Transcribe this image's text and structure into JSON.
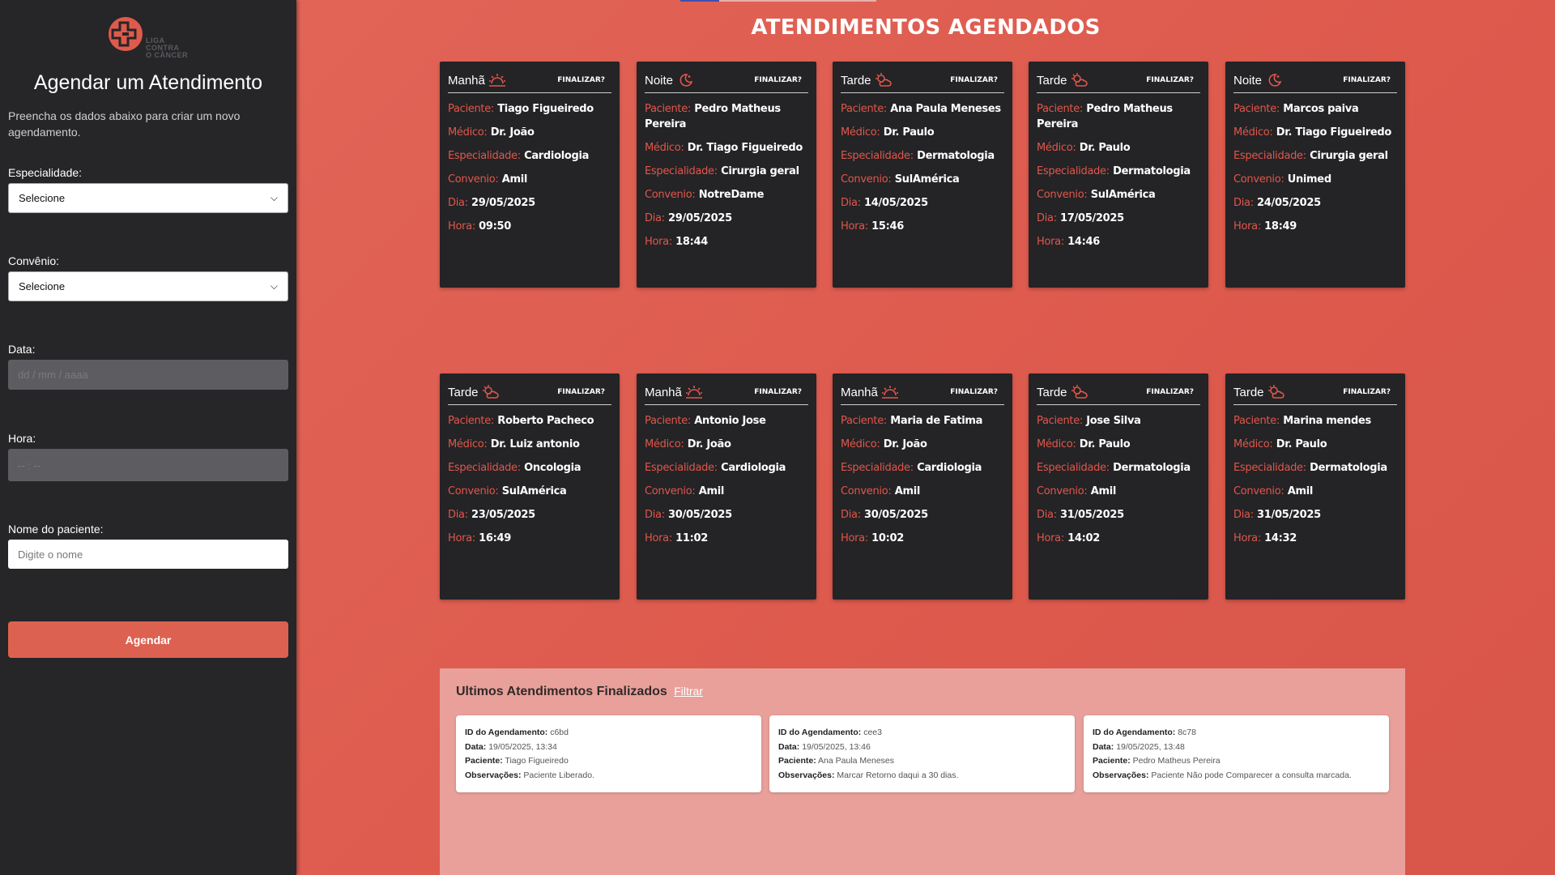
{
  "sidebar": {
    "logo_lines": [
      "LIGA",
      "CONTRA",
      "O CÂNCER"
    ],
    "title": "Agendar um Atendimento",
    "description": "Preencha os dados abaixo para criar um novo agendamento.",
    "specialty": {
      "label": "Especialidade:",
      "value": "Selecione"
    },
    "insurance": {
      "label": "Convênio:",
      "value": "Selecione"
    },
    "date": {
      "label": "Data:",
      "placeholder": "dd / mm / aaaa"
    },
    "time": {
      "label": "Hora:",
      "placeholder": "-- : --"
    },
    "patient": {
      "label": "Nome do paciente:",
      "placeholder": "Digite o nome"
    },
    "submit_label": "Agendar"
  },
  "main": {
    "title": "ATENDIMENTOS AGENDADOS",
    "finalize_label": "FINALIZAR?",
    "field_labels": {
      "patient": "Paciente:",
      "doctor": "Médico:",
      "specialty": "Especialidade:",
      "insurance": "Convenio:",
      "day": "Dia:",
      "hour": "Hora:"
    },
    "appointments": [
      {
        "period": "Manhã",
        "icon": "sunrise-icon",
        "patient": "Tiago Figueiredo",
        "doctor": "Dr. João",
        "specialty": "Cardiologia",
        "insurance": "Amil",
        "day": "29/05/2025",
        "hour": "09:50"
      },
      {
        "period": "Noite",
        "icon": "moon-icon",
        "patient": "Pedro Matheus Pereira",
        "doctor": "Dr. Tiago Figueiredo",
        "specialty": "Cirurgia geral",
        "insurance": "NotreDame",
        "day": "29/05/2025",
        "hour": "18:44"
      },
      {
        "period": "Tarde",
        "icon": "sun-cloud-icon",
        "patient": "Ana Paula Meneses",
        "doctor": "Dr. Paulo",
        "specialty": "Dermatologia",
        "insurance": "SulAmérica",
        "day": "14/05/2025",
        "hour": "15:46"
      },
      {
        "period": "Tarde",
        "icon": "sun-cloud-icon",
        "patient": "Pedro Matheus Pereira",
        "doctor": "Dr. Paulo",
        "specialty": "Dermatologia",
        "insurance": "SulAmérica",
        "day": "17/05/2025",
        "hour": "14:46"
      },
      {
        "period": "Noite",
        "icon": "moon-icon",
        "patient": "Marcos paiva",
        "doctor": "Dr. Tiago Figueiredo",
        "specialty": "Cirurgia geral",
        "insurance": "Unimed",
        "day": "24/05/2025",
        "hour": "18:49"
      },
      {
        "period": "Tarde",
        "icon": "sun-cloud-icon",
        "patient": "Roberto Pacheco",
        "doctor": "Dr. Luiz antonio",
        "specialty": "Oncologia",
        "insurance": "SulAmérica",
        "day": "23/05/2025",
        "hour": "16:49"
      },
      {
        "period": "Manhã",
        "icon": "sunrise-icon",
        "patient": "Antonio Jose",
        "doctor": "Dr. João",
        "specialty": "Cardiologia",
        "insurance": "Amil",
        "day": "30/05/2025",
        "hour": "11:02"
      },
      {
        "period": "Manhã",
        "icon": "sunrise-icon",
        "patient": "Maria de Fatima",
        "doctor": "Dr. João",
        "specialty": "Cardiologia",
        "insurance": "Amil",
        "day": "30/05/2025",
        "hour": "10:02"
      },
      {
        "period": "Tarde",
        "icon": "sun-cloud-icon",
        "patient": "Jose Silva",
        "doctor": "Dr. Paulo",
        "specialty": "Dermatologia",
        "insurance": "Amil",
        "day": "31/05/2025",
        "hour": "14:02"
      },
      {
        "period": "Tarde",
        "icon": "sun-cloud-icon",
        "patient": "Marina mendes",
        "doctor": "Dr. Paulo",
        "specialty": "Dermatologia",
        "insurance": "Amil",
        "day": "31/05/2025",
        "hour": "14:32"
      }
    ]
  },
  "finished": {
    "title": "Ultimos Atendimentos Finalizados",
    "filter_label": "Filtrar",
    "labels": {
      "id": "ID do Agendamento:",
      "date": "Data:",
      "patient": "Paciente:",
      "notes": "Observações:"
    },
    "items": [
      {
        "id": "c6bd",
        "date": "19/05/2025, 13:34",
        "patient": "Tiago Figueiredo",
        "notes": "Paciente Liberado."
      },
      {
        "id": "cee3",
        "date": "19/05/2025, 13:46",
        "patient": "Ana Paula Meneses",
        "notes": "Marcar Retorno daqui a 30 dias."
      },
      {
        "id": "8c78",
        "date": "19/05/2025, 13:48",
        "patient": "Pedro Matheus Pereira",
        "notes": "Paciente Não pode Comparecer a consulta marcada."
      }
    ]
  },
  "colors": {
    "accent": "#dd6150",
    "card_bg": "#242326",
    "sidebar_bg": "#262528",
    "label_red": "#e0574a",
    "panel_bg": "#e9a09a"
  }
}
